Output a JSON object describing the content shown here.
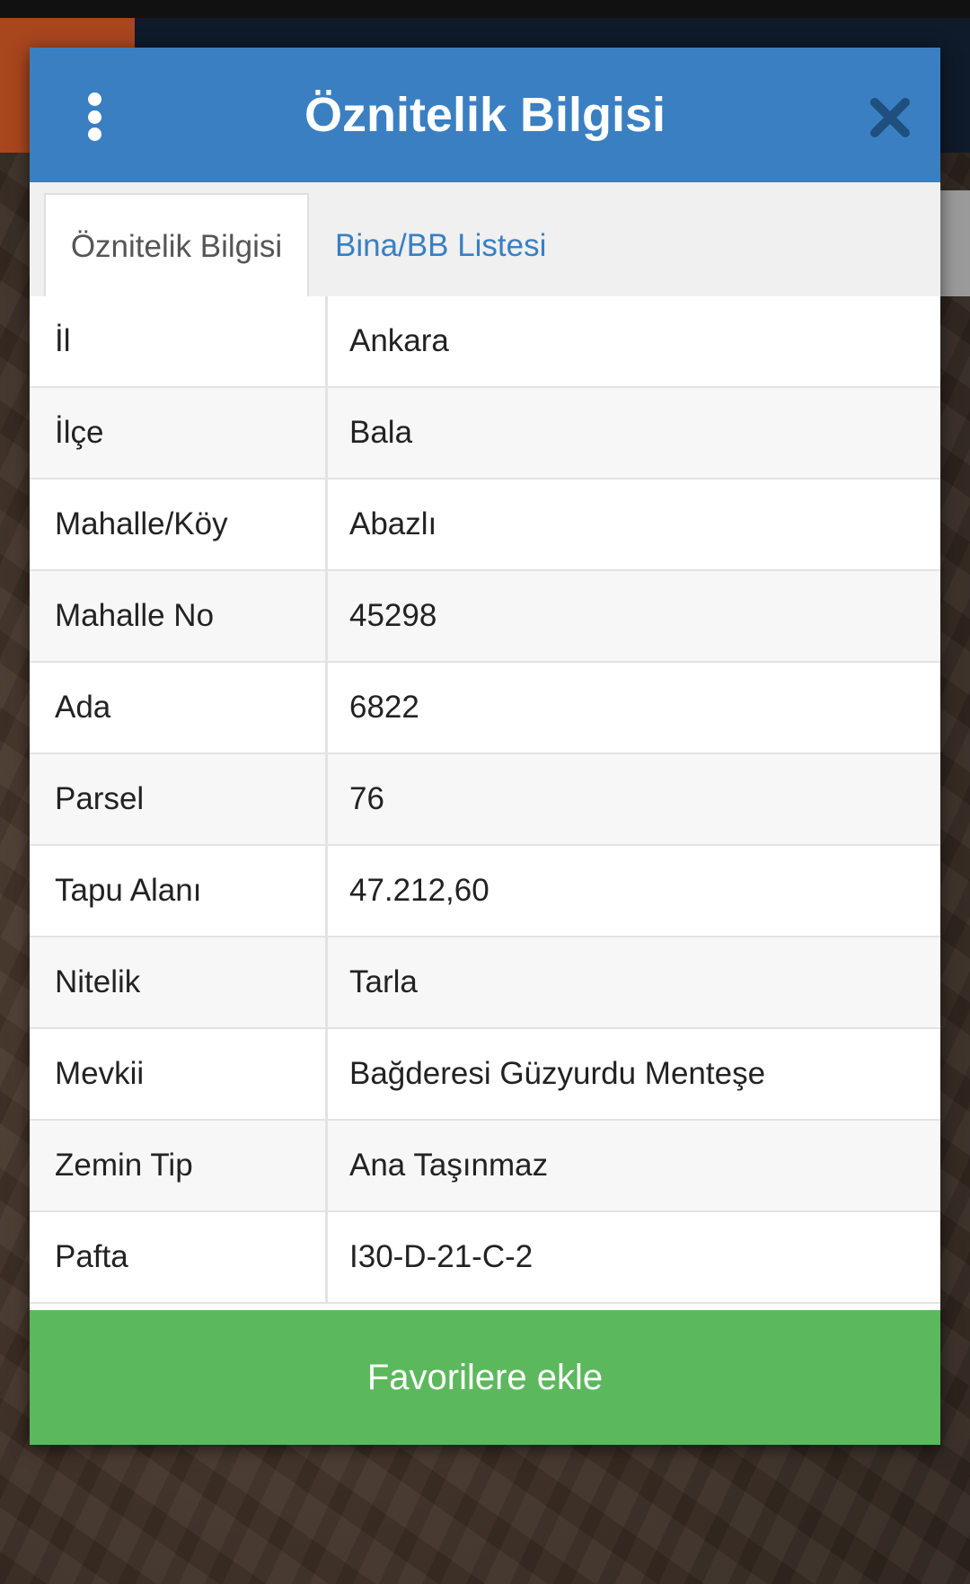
{
  "dialog": {
    "title": "Öznitelik Bilgisi",
    "menu_icon": "more-vertical-icon",
    "close_icon": "close-icon"
  },
  "tabs": [
    {
      "label": "Öznitelik Bilgisi",
      "active": true
    },
    {
      "label": "Bina/BB Listesi",
      "active": false
    }
  ],
  "attributes": [
    {
      "label": "İl",
      "value": "Ankara"
    },
    {
      "label": "İlçe",
      "value": "Bala"
    },
    {
      "label": "Mahalle/Köy",
      "value": "Abazlı"
    },
    {
      "label": "Mahalle No",
      "value": "45298"
    },
    {
      "label": "Ada",
      "value": "6822"
    },
    {
      "label": "Parsel",
      "value": "76"
    },
    {
      "label": "Tapu Alanı",
      "value": "47.212,60"
    },
    {
      "label": "Nitelik",
      "value": "Tarla"
    },
    {
      "label": "Mevkii",
      "value": "Bağderesi Güzyurdu Menteşe"
    },
    {
      "label": "Zemin Tip",
      "value": "Ana Taşınmaz"
    },
    {
      "label": "Pafta",
      "value": "I30-D-21-C-2"
    }
  ],
  "footer": {
    "favorite_label": "Favorilere ekle"
  },
  "colors": {
    "header": "#3a7fc1",
    "button": "#5cb85c",
    "close_icon": "#1f4f7e"
  }
}
